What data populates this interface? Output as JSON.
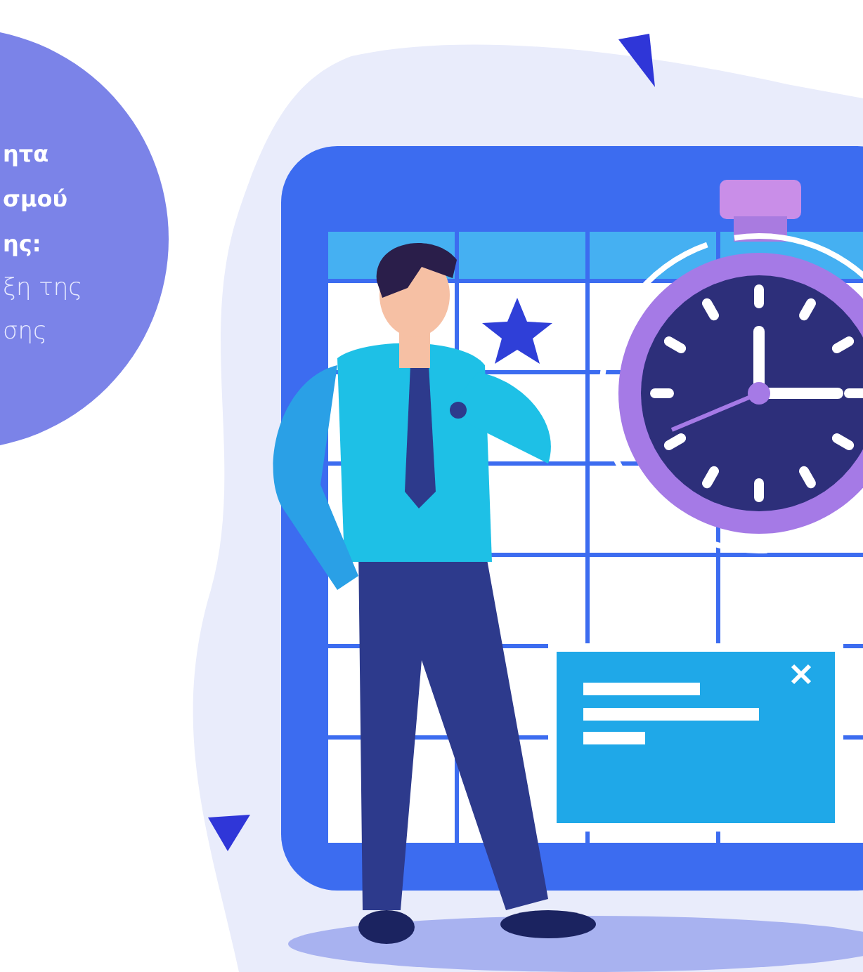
{
  "info_circle": {
    "heading_lines": [
      "ητα",
      "σμού",
      "ης:"
    ],
    "body_lines": [
      "ξη της",
      "σης"
    ]
  }
}
